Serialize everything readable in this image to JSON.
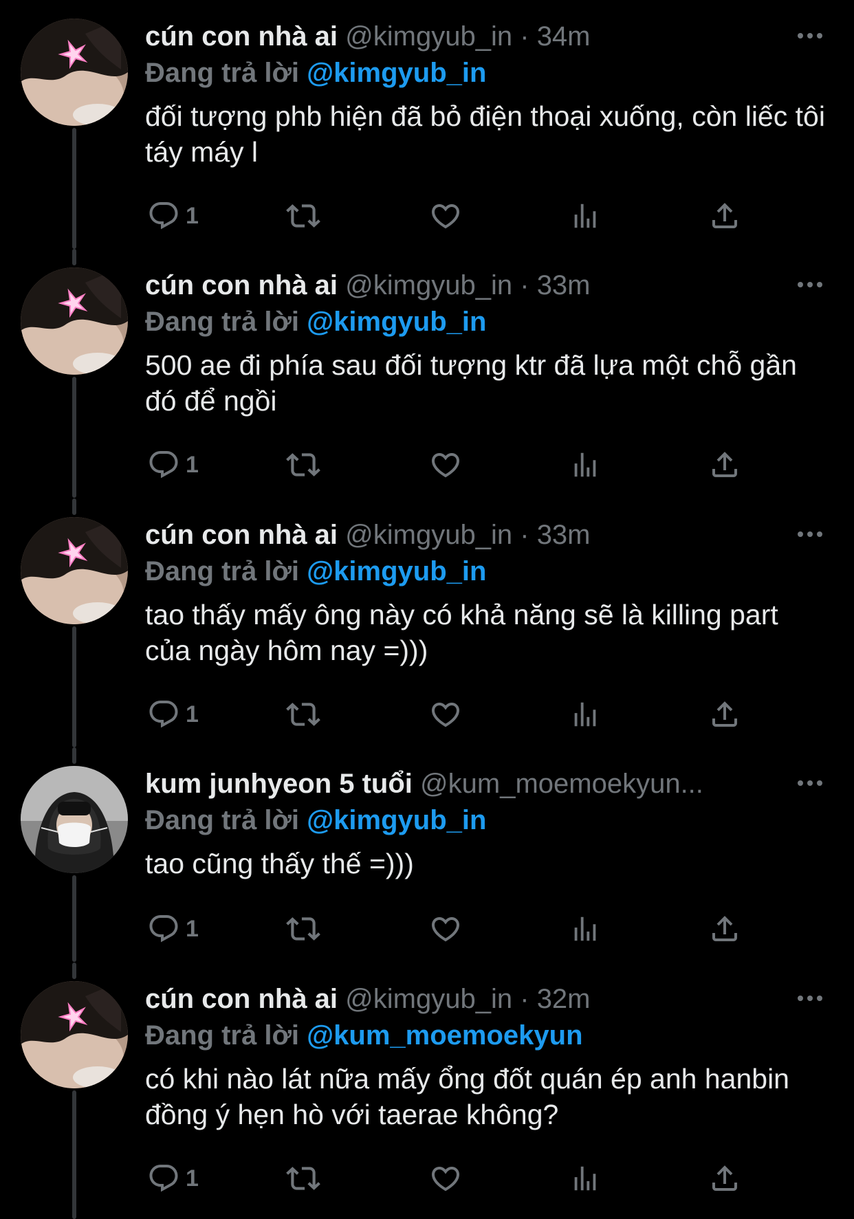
{
  "colors": {
    "background": "#000000",
    "primary_text": "#e7e9ea",
    "secondary_text": "#71767b",
    "link": "#1d9bf0",
    "thread_line": "#333639"
  },
  "icons": [
    "more-icon",
    "reply-icon",
    "retweet-icon",
    "like-icon",
    "views-icon",
    "share-icon"
  ],
  "tweets": [
    {
      "name": "cún con nhà ai",
      "handle": "@kimgyub_in",
      "dot": "·",
      "time": "34m",
      "reply_label": "Đang trả lời",
      "reply_to": "@kimgyub_in",
      "text": "đối tượng phb hiện đã bỏ điện thoại xuống, còn liếc tôi táy máy l",
      "reply_count": "1",
      "avatar": "avatar-cun-con"
    },
    {
      "name": "cún con nhà ai",
      "handle": "@kimgyub_in",
      "dot": "·",
      "time": "33m",
      "reply_label": "Đang trả lời",
      "reply_to": "@kimgyub_in",
      "text": "500 ae đi phía sau đối tượng ktr đã lựa một chỗ gần đó để ngồi",
      "reply_count": "1",
      "avatar": "avatar-cun-con"
    },
    {
      "name": "cún con nhà ai",
      "handle": "@kimgyub_in",
      "dot": "·",
      "time": "33m",
      "reply_label": "Đang trả lời",
      "reply_to": "@kimgyub_in",
      "text": "tao thấy mấy ông này có khả năng sẽ là killing part của ngày hôm nay =)))",
      "reply_count": "1",
      "avatar": "avatar-cun-con"
    },
    {
      "name": "kum junhyeon 5 tuổi",
      "handle": "@kum_moemoekyun...",
      "dot": "",
      "time": "",
      "reply_label": "Đang trả lời",
      "reply_to": "@kimgyub_in",
      "text": "tao cũng thấy thế =)))",
      "reply_count": "1",
      "avatar": "avatar-kum-junhyeon"
    },
    {
      "name": "cún con nhà ai",
      "handle": "@kimgyub_in",
      "dot": "·",
      "time": "32m",
      "reply_label": "Đang trả lời",
      "reply_to": "@kum_moemoekyun",
      "text": "có khi nào lát nữa mấy ổng đốt quán ép anh hanbin đồng ý hẹn hò với taerae không?",
      "reply_count": "1",
      "avatar": "avatar-cun-con"
    }
  ]
}
